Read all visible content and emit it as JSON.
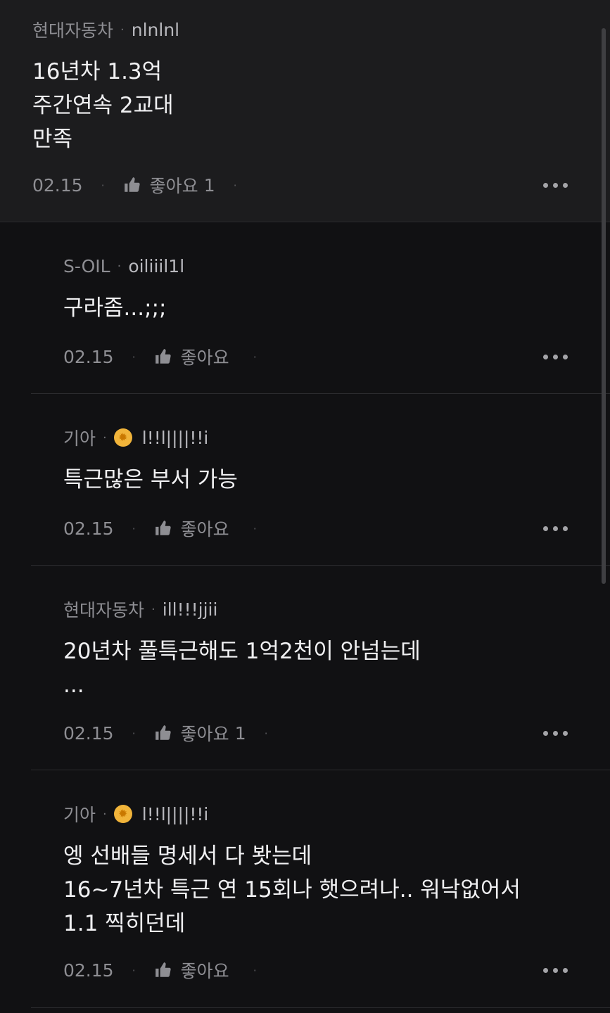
{
  "comments": [
    {
      "company": "현대자동차",
      "nickname": "nlnlnl",
      "badge": false,
      "text": "16년차 1.3억\n주간연속 2교대\n만족",
      "date": "02.15",
      "like_label": "좋아요",
      "like_count": "1"
    },
    {
      "company": "S-OIL",
      "nickname": "oiliiil1l",
      "badge": false,
      "text": "구라좀...;;;",
      "date": "02.15",
      "like_label": "좋아요",
      "like_count": ""
    },
    {
      "company": "기아",
      "nickname": "l!!l||||!!i",
      "badge": true,
      "text": "특근많은 부서 가능",
      "date": "02.15",
      "like_label": "좋아요",
      "like_count": ""
    },
    {
      "company": "현대자동차",
      "nickname": "ill!!!jjii",
      "badge": false,
      "text": "20년차  풀특근해도 1억2천이  안넘는데\n...",
      "date": "02.15",
      "like_label": "좋아요",
      "like_count": "1"
    },
    {
      "company": "기아",
      "nickname": "l!!l||||!!i",
      "badge": true,
      "text": "엥 선배들 명세서 다 봣는데\n16~7년차 특근 연 15회나 햇으려나.. 워낙없어서\n1.1 찍히던데",
      "date": "02.15",
      "like_label": "좋아요",
      "like_count": ""
    }
  ],
  "colors": {
    "background": "#111113",
    "top_comment_bg": "#1c1c1e",
    "badge": "#f1b43a"
  },
  "icons": {
    "like": "thumbs-up-icon",
    "more": "more-dots-icon",
    "badge": "verified-badge-icon"
  }
}
